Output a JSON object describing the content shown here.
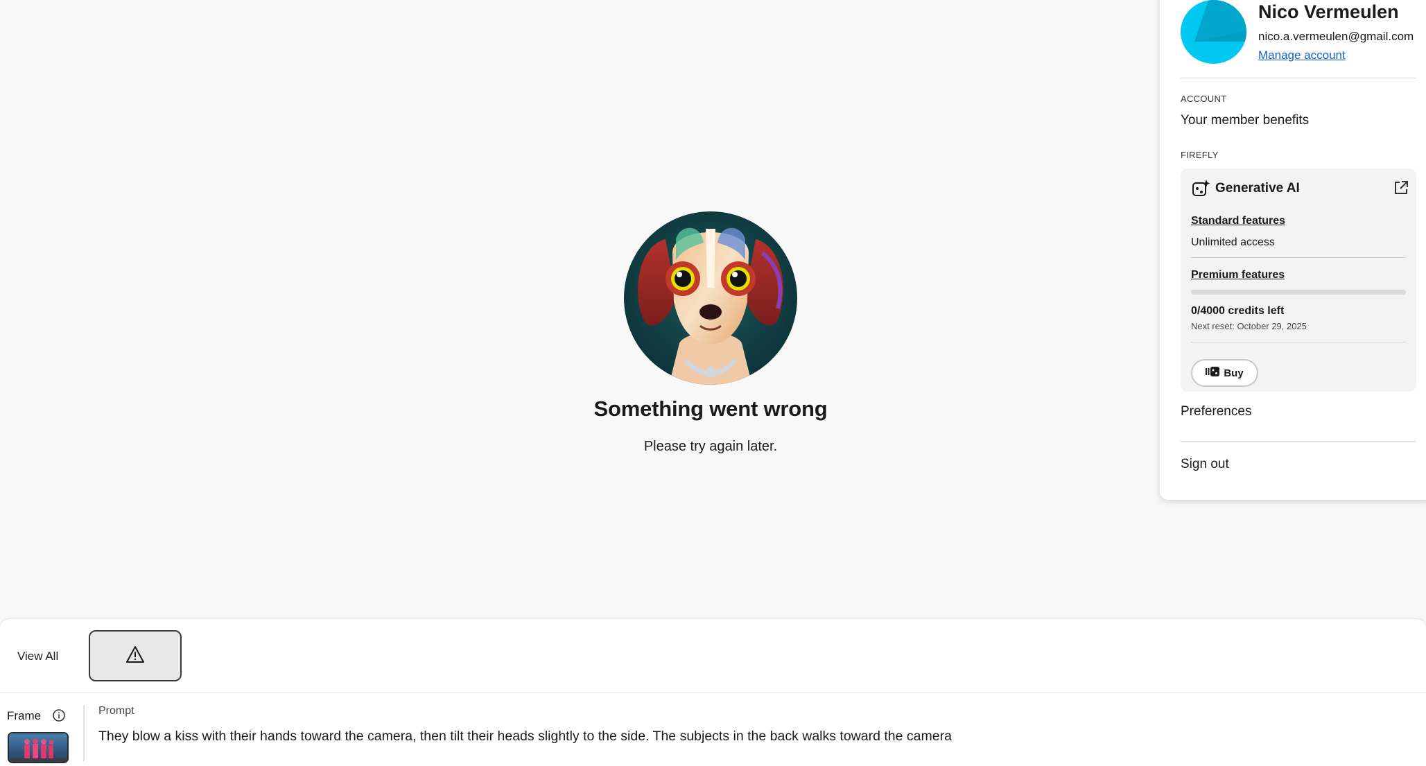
{
  "error": {
    "title": "Something went wrong",
    "message": "Please try again later.",
    "illustration": "dog-illustration"
  },
  "account": {
    "name": "Nico Vermeulen",
    "email": "nico.a.vermeulen@gmail.com",
    "manage_link": "Manage account",
    "avatar_color": "#00c8f0",
    "account_section": "ACCOUNT",
    "member_benefits": "Your member benefits",
    "firefly_section": "FIREFLY",
    "generative_ai": {
      "title": "Generative AI",
      "standard_label": "Standard features",
      "standard_value": "Unlimited access",
      "premium_label": "Premium features",
      "credits_used_fraction": 0,
      "credits_left": "0/4000 credits left",
      "next_reset": "Next reset: October 29, 2025",
      "buy_label": "Buy"
    },
    "preferences": "Preferences",
    "sign_out": "Sign out"
  },
  "bottom": {
    "view_all": "View All",
    "frame_label": "Frame",
    "prompt_label": "Prompt",
    "prompt_text": "They blow a kiss with their hands toward the camera, then tilt their heads slightly to the side. The subjects in the back walks toward the camera"
  },
  "colors": {
    "background": "#f8f8f8",
    "link": "#1060c8",
    "avatar": "#00c8f0"
  }
}
